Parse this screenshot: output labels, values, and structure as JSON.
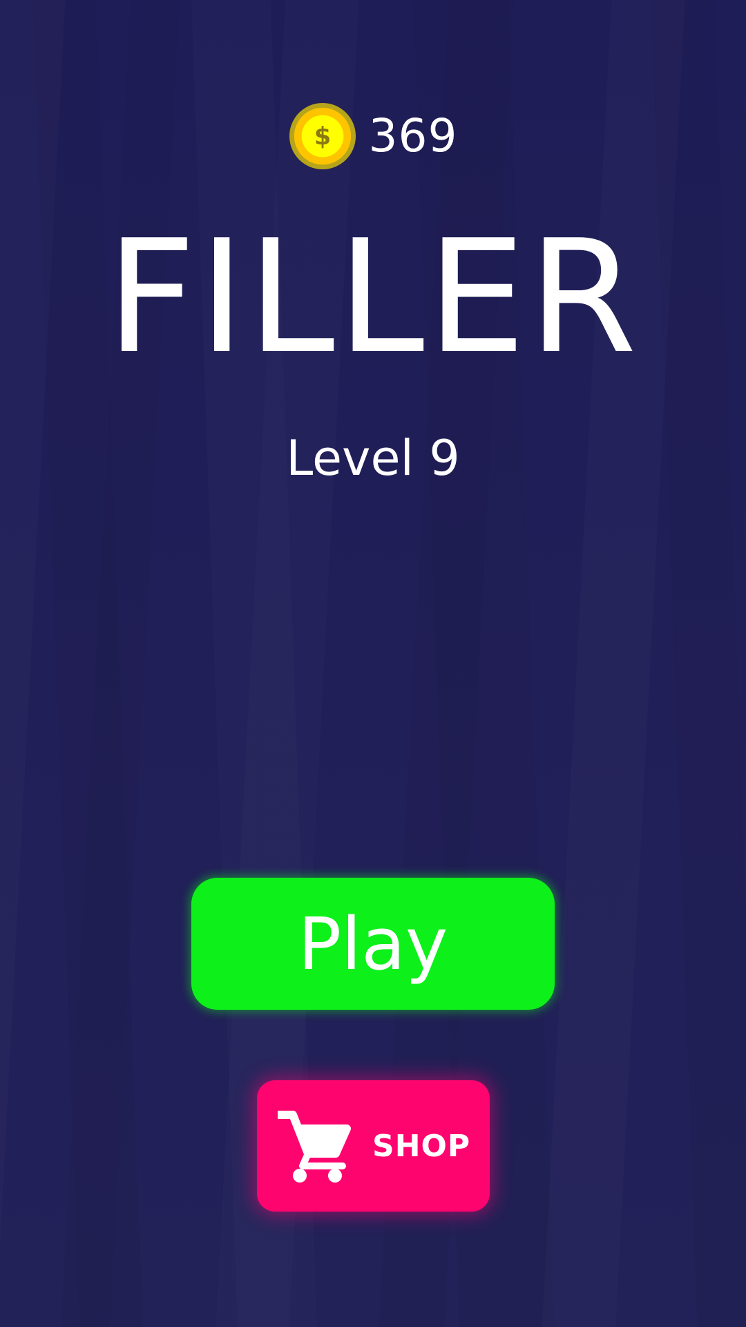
{
  "coins": {
    "icon": "coin-icon",
    "symbol": "$",
    "count": "369"
  },
  "title": "FILLER",
  "level": "Level 9",
  "play_button": {
    "label": "Play"
  },
  "shop_button": {
    "icon": "cart-icon",
    "label": "SHOP"
  },
  "colors": {
    "background": "#212058",
    "play": "#0ef01a",
    "shop": "#fe046f",
    "coin": "#ffff00"
  }
}
